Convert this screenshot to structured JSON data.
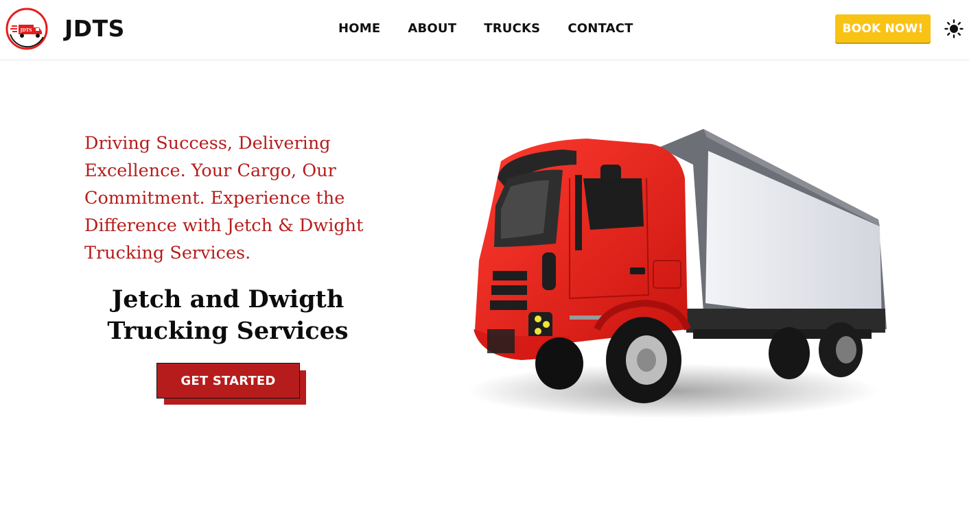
{
  "brand": {
    "name": "JDTS",
    "logo_text": "JDTS",
    "logo_icon": "truck-logo-icon"
  },
  "nav": {
    "items": [
      {
        "label": "HOME"
      },
      {
        "label": "ABOUT"
      },
      {
        "label": "TRUCKS"
      },
      {
        "label": "CONTACT"
      }
    ],
    "book_label": "BOOK NOW!",
    "theme_icon": "sun-icon"
  },
  "hero": {
    "tagline": "Driving Success, Delivering Excellence. Your Cargo, Our Commitment. Experience the Difference with Jetch & Dwight Trucking Services.",
    "title": "Jetch and Dwigth\nTrucking Services",
    "cta_label": "GET STARTED",
    "image_icon": "red-box-truck-illustration"
  },
  "colors": {
    "accent_red": "#b71c1c",
    "book_yellow": "#f9c315",
    "truck_red": "#e8231f"
  }
}
